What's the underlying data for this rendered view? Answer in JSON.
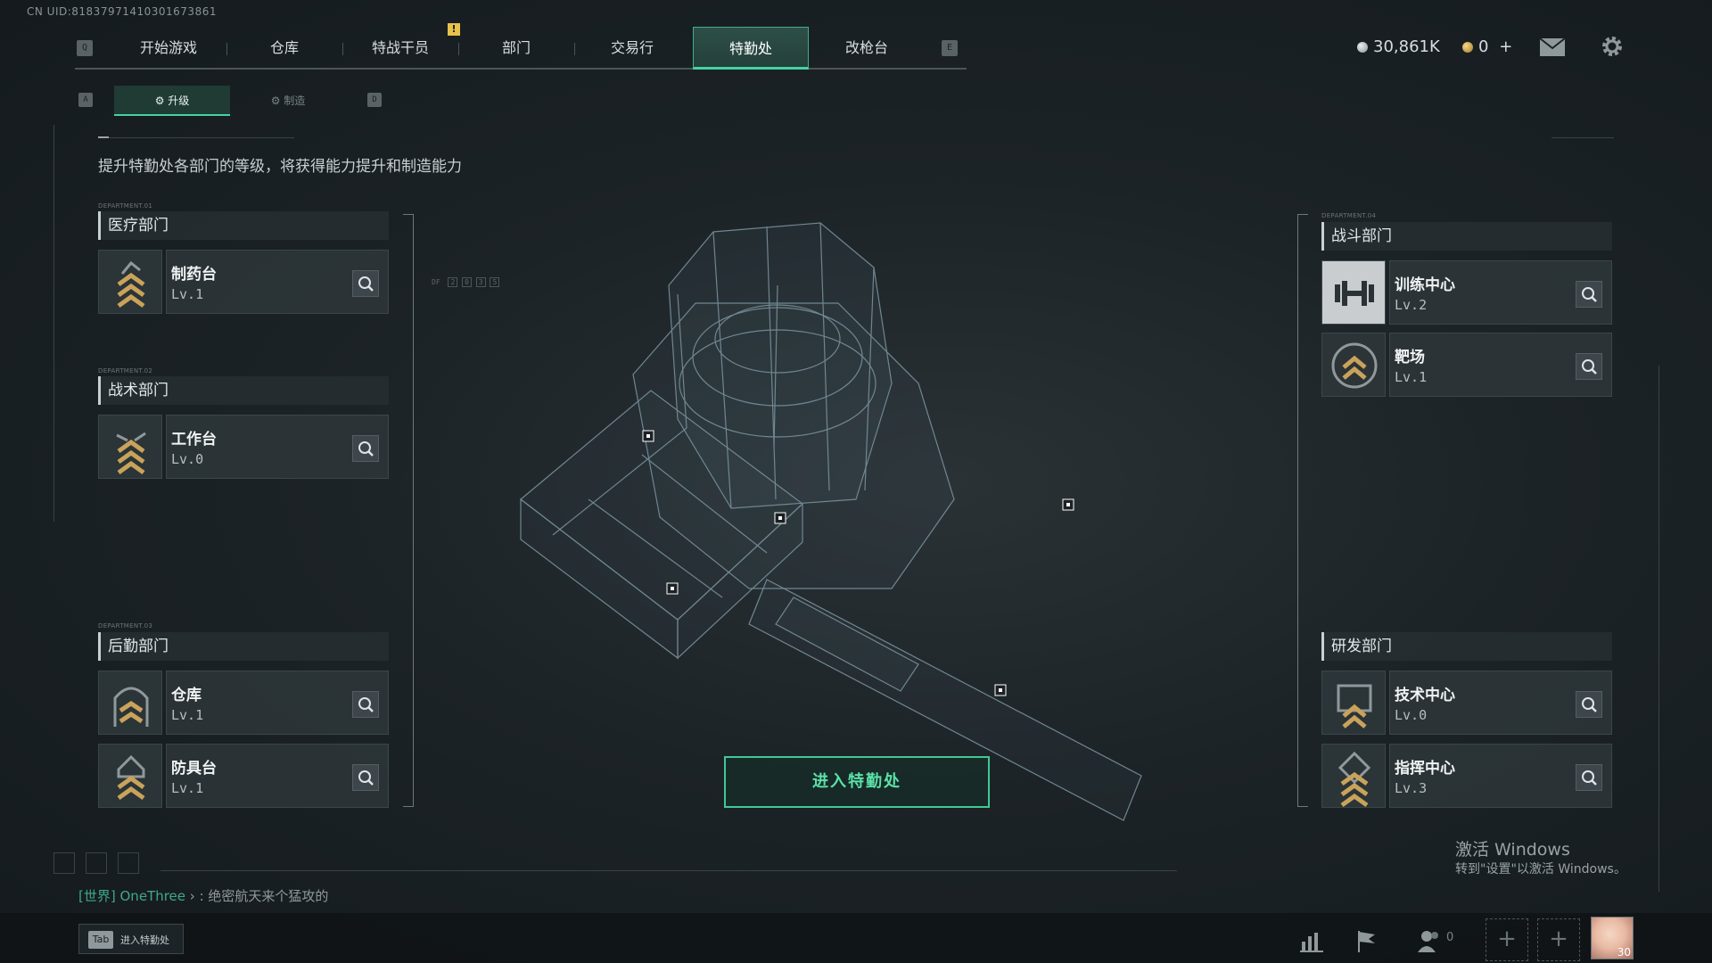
{
  "uid": "CN UID:81837971410301673861",
  "nav": {
    "q_key": "Q",
    "e_key": "E",
    "tabs": [
      "开始游戏",
      "仓库",
      "特战干员",
      "部门",
      "交易行",
      "特勤处",
      "改枪台"
    ],
    "active": "特勤处",
    "alert_badge": "!"
  },
  "currency": {
    "silver": "30,861K",
    "gold": "0",
    "add": "+"
  },
  "subtabs": {
    "a_key": "A",
    "d_key": "D",
    "upgrade": "升级",
    "craft": "制造"
  },
  "description": "提升特勤处各部门的等级，将获得能力提升和制造能力",
  "departments": {
    "medical": {
      "code": "DEPARTMENT.01",
      "title": "医疗部门",
      "items": [
        {
          "name": "制药台",
          "level": "Lv.1"
        }
      ]
    },
    "tactical": {
      "code": "DEPARTMENT.02",
      "title": "战术部门",
      "items": [
        {
          "name": "工作台",
          "level": "Lv.0"
        }
      ]
    },
    "logistics": {
      "code": "DEPARTMENT.03",
      "title": "后勤部门",
      "items": [
        {
          "name": "仓库",
          "level": "Lv.1"
        },
        {
          "name": "防具台",
          "level": "Lv.1"
        }
      ]
    },
    "combat": {
      "code": "DEPARTMENT.04",
      "title": "战斗部门",
      "items": [
        {
          "name": "训练中心",
          "level": "Lv.2"
        },
        {
          "name": "靶场",
          "level": "Lv.1"
        }
      ]
    },
    "research": {
      "title": "研发部门",
      "items": [
        {
          "name": "技术中心",
          "level": "Lv.0"
        },
        {
          "name": "指挥中心",
          "level": "Lv.3"
        }
      ]
    }
  },
  "hud": {
    "df_code": "DF",
    "df_digits": [
      "2",
      "0",
      "3",
      "5"
    ]
  },
  "enter_button": "进入特勤处",
  "windows_watermark": {
    "line1": "激活 Windows",
    "line2": "转到\"设置\"以激活 Windows。"
  },
  "chat": {
    "channel": "[世界]",
    "user": "OneThree",
    "separator": "›",
    "message": ": 绝密航天来个猛攻的"
  },
  "bottom": {
    "tab_key": "Tab",
    "tab_label": "进入特勤处",
    "friends_count": "0",
    "avatar_level": "30"
  },
  "icons": [
    "search-icon",
    "mail-icon",
    "settings-icon",
    "dumbbell-icon",
    "chevron-rank-icon",
    "stats-icon",
    "flag-icon",
    "friends-icon",
    "add-icon"
  ],
  "colors": {
    "accent": "#45d3a1",
    "alert": "#e8c14a",
    "background": "#1c2327"
  }
}
